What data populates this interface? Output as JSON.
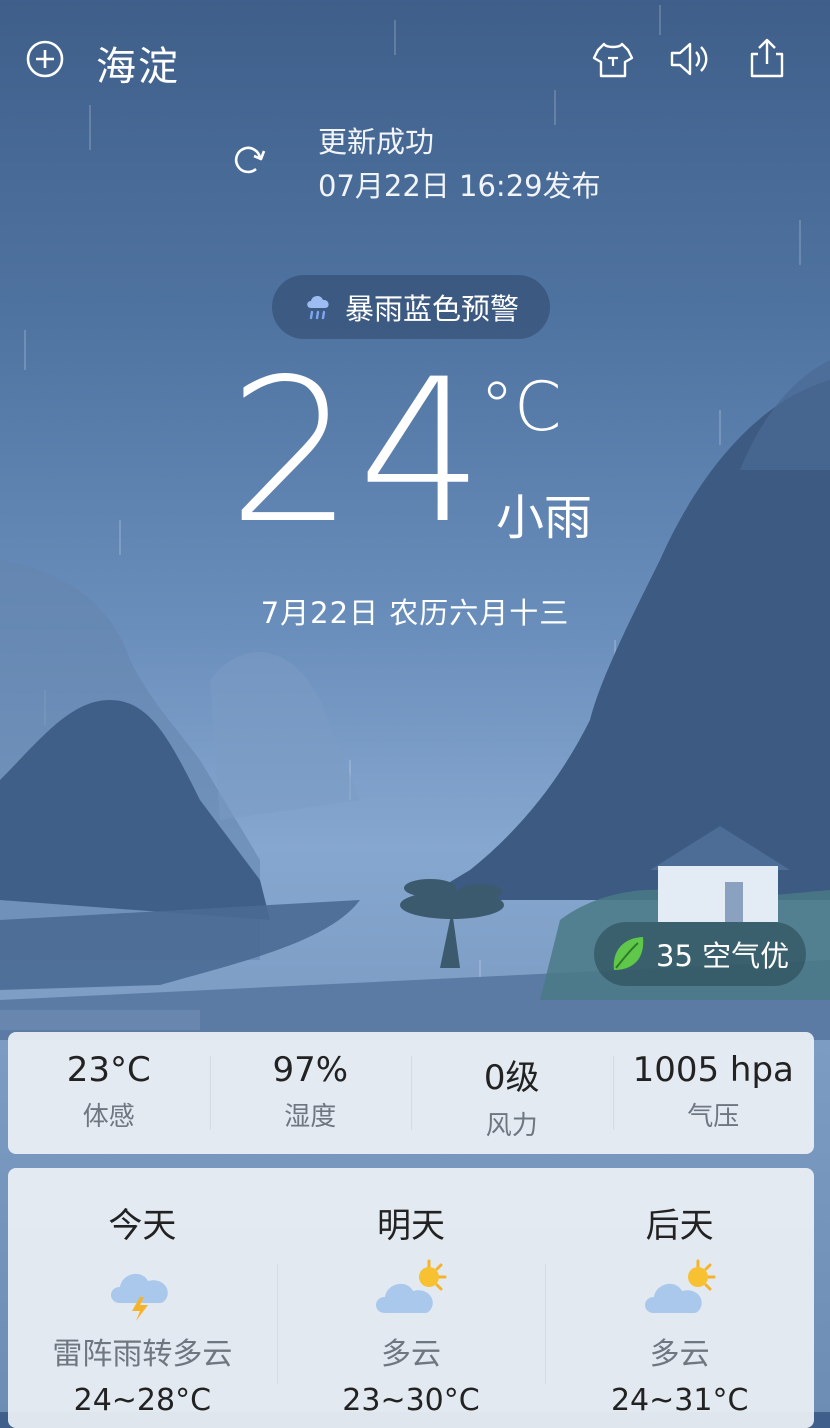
{
  "header": {
    "city": "海淀",
    "icons": [
      "add-city-icon",
      "shirt-icon",
      "speaker-icon",
      "share-icon"
    ]
  },
  "update": {
    "status": "更新成功",
    "published": "07月22日 16:29发布"
  },
  "alert": {
    "label": "暴雨蓝色预警"
  },
  "current": {
    "temperature": "24",
    "unit": "°C",
    "condition": "小雨",
    "date": "7月22日  农历六月十三"
  },
  "air_quality": {
    "label": "35 空气优"
  },
  "stats": [
    {
      "value": "23°C",
      "label": "体感"
    },
    {
      "value": "97%",
      "label": "湿度"
    },
    {
      "value": "0级",
      "label": "风力"
    },
    {
      "value": "1005 hpa",
      "label": "气压"
    }
  ],
  "forecast": [
    {
      "day": "今天",
      "desc": "雷阵雨转多云",
      "temp": "24~28°C",
      "icon": "thunder-cloud-icon"
    },
    {
      "day": "明天",
      "desc": "多云",
      "temp": "23~30°C",
      "icon": "partly-cloudy-icon"
    },
    {
      "day": "后天",
      "desc": "多云",
      "temp": "24~31°C",
      "icon": "partly-cloudy-icon"
    }
  ],
  "colors": {
    "sky_top": "#3f5f8a",
    "mountain": "#3c5a82",
    "card": "#ecf0f5",
    "leaf": "#5fc84a"
  }
}
